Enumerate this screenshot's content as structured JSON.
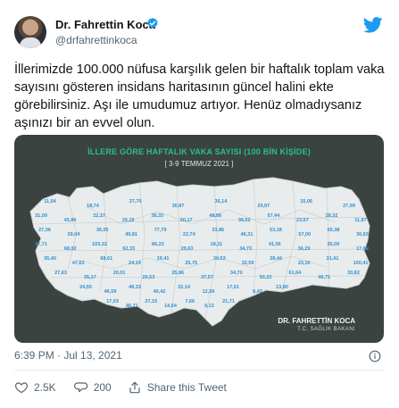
{
  "author": {
    "name": "Dr. Fahrettin Koca",
    "handle": "@drfahrettinkoca"
  },
  "tweet": {
    "text": "İllerimizde 100.000 nüfusa karşılık gelen bir haftalık toplam vaka sayısını gösteren insidans haritasının güncel halini ekte görebilirsiniz. Aşı ile umudumuz artıyor. Henüz olmadıysanız aşınızı bir an evvel olun.",
    "timestamp": "6:39 PM · Jul 13, 2021"
  },
  "map_image": {
    "title": "İLLERE GÖRE HAFTALIK VAKA SAYISI (100 BİN KİŞİDE)",
    "date_range": "[ 3-9 TEMMUZ 2021 ]",
    "signature_name": "DR. FAHRETTİN KOCA",
    "signature_title": "T.C. SAĞLIK BAKANI",
    "province_values": [
      "11,04",
      "18,74",
      "27,70",
      "30,87",
      "36,14",
      "29,97",
      "15,06",
      "27,99",
      "31,09",
      "43,86",
      "22,17",
      "29,19",
      "38,33",
      "50,17",
      "48,86",
      "36,52",
      "57,44",
      "23,67",
      "28,32",
      "11,87",
      "27,36",
      "29,04",
      "36,05",
      "49,81",
      "77,79",
      "22,74",
      "33,86",
      "46,31",
      "53,18",
      "57,00",
      "65,38",
      "30,63",
      "47,71",
      "68,92",
      "103,32",
      "62,33",
      "86,22",
      "29,63",
      "18,11",
      "34,73",
      "41,56",
      "36,29",
      "35,09",
      "17,69",
      "35,40",
      "47,63",
      "68,61",
      "24,14",
      "19,41",
      "25,75",
      "30,53",
      "32,59",
      "28,44",
      "23,10",
      "31,41",
      "100,41",
      "27,63",
      "35,17",
      "20,01",
      "26,53",
      "25,86",
      "37,57",
      "34,70",
      "50,22",
      "61,64",
      "46,71",
      "33,82",
      "24,55",
      "46,59",
      "48,33",
      "40,42",
      "22,14",
      "12,56",
      "17,51",
      "8,43",
      "13,80",
      "17,03",
      "40,71",
      "27,15",
      "14,54",
      "7,66",
      "9,13",
      "21,71"
    ],
    "colors": {
      "background": "#3b4341",
      "map_fill": "#e9ecec",
      "title": "#27c08a",
      "value_text": "#2e8fd0"
    }
  },
  "actions": {
    "likes": "2.5K",
    "replies": "200",
    "share_label": "Share this Tweet"
  },
  "colors": {
    "twitter_blue": "#1d9bf0",
    "secondary_text": "#536471"
  }
}
